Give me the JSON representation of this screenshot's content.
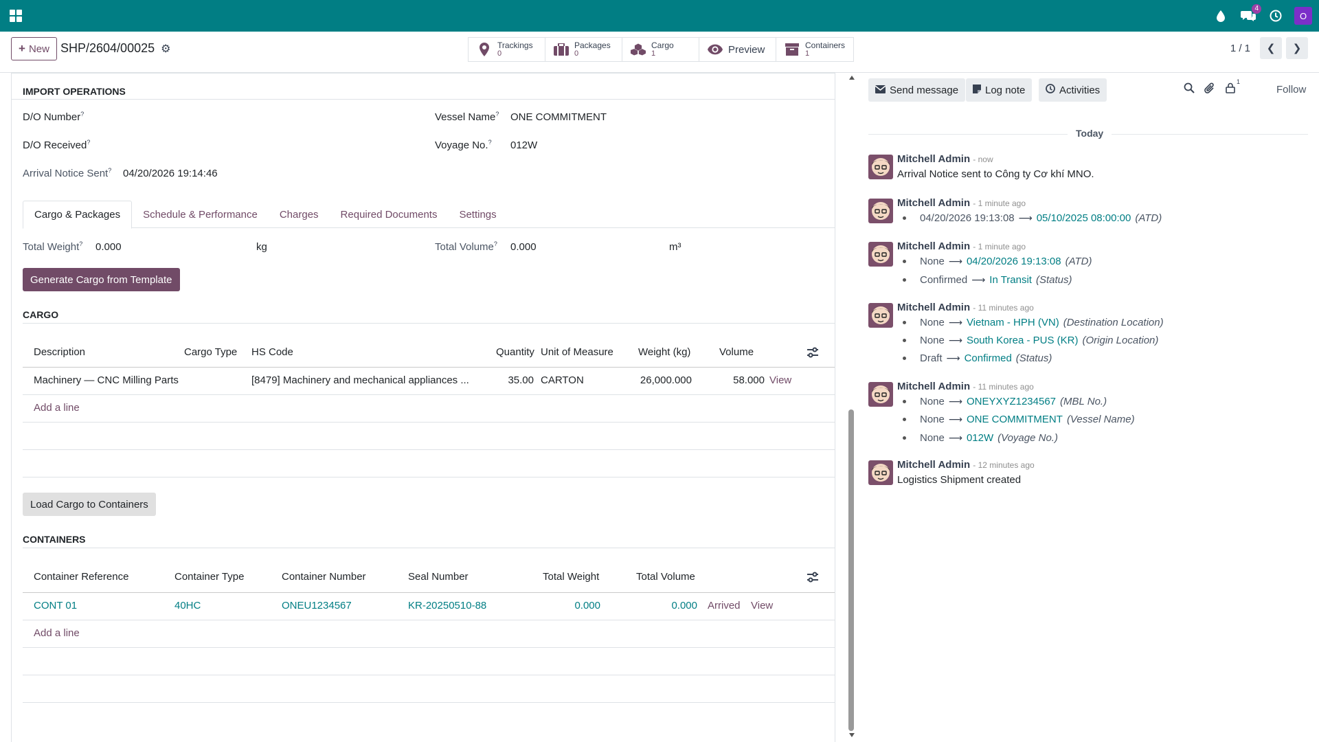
{
  "navbar": {
    "notif_count": "4",
    "avatar_letter": "O"
  },
  "control": {
    "new_label": "New",
    "record_name": "SHP/2604/00025",
    "smart_buttons": [
      {
        "label": "Trackings",
        "value": "0"
      },
      {
        "label": "Packages",
        "value": "0"
      },
      {
        "label": "Cargo",
        "value": "1"
      },
      {
        "label": "Preview",
        "value": ""
      },
      {
        "label": "Containers",
        "value": "1"
      }
    ],
    "pager": "1 / 1"
  },
  "form": {
    "import_ops_title": "IMPORT OPERATIONS",
    "do_number_label": "D/O Number",
    "do_received_label": "D/O Received",
    "arrival_notice_label": "Arrival Notice Sent",
    "arrival_notice_value": "04/20/2026 19:14:46",
    "vessel_name_label": "Vessel Name",
    "vessel_name_value": "ONE COMMITMENT",
    "voyage_label": "Voyage No.",
    "voyage_value": "012W",
    "help_mark": "?",
    "tabs": [
      {
        "label": "Cargo & Packages"
      },
      {
        "label": "Schedule & Performance"
      },
      {
        "label": "Charges"
      },
      {
        "label": "Required Documents"
      },
      {
        "label": "Settings"
      }
    ],
    "total_weight_label": "Total Weight",
    "total_weight_value": "0.000",
    "total_weight_unit": "kg",
    "total_volume_label": "Total Volume",
    "total_volume_value": "0.000",
    "total_volume_unit": "m³",
    "generate_btn": "Generate Cargo from Template",
    "cargo_title": "CARGO",
    "cargo_headers": [
      "Description",
      "Cargo Type",
      "HS Code",
      "Quantity",
      "Unit of Measure",
      "Weight (kg)",
      "Volume"
    ],
    "cargo_row": {
      "description": "Machinery — CNC Milling Parts",
      "cargo_type": "",
      "hs_code": "[8479] Machinery and mechanical appliances ...",
      "quantity": "35.00",
      "uom": "CARTON",
      "weight": "26,000.000",
      "volume": "58.000",
      "view": "View"
    },
    "add_line": "Add a line",
    "load_btn": "Load Cargo to Containers",
    "containers_title": "CONTAINERS",
    "container_headers": [
      "Container Reference",
      "Container Type",
      "Container Number",
      "Seal Number",
      "Total Weight",
      "Total Volume"
    ],
    "container_row": {
      "reference": "CONT 01",
      "type": "40HC",
      "number": "ONEU1234567",
      "seal": "KR-20250510-88",
      "weight": "0.000",
      "volume": "0.000",
      "status": "Arrived",
      "view": "View"
    }
  },
  "chatter": {
    "send_message": "Send message",
    "log_note": "Log note",
    "activities": "Activities",
    "followers_count": "1",
    "follow": "Follow",
    "today": "Today",
    "messages": [
      {
        "author": "Mitchell Admin",
        "time": "- now",
        "body": "Arrival Notice sent to Công ty Cơ khí MNO."
      },
      {
        "author": "Mitchell Admin",
        "time": "- 1 minute ago",
        "tracking": [
          {
            "old": "04/20/2026 19:13:08",
            "new": "05/10/2025 08:00:00",
            "field": "(ATD)"
          }
        ]
      },
      {
        "author": "Mitchell Admin",
        "time": "- 1 minute ago",
        "tracking": [
          {
            "old": "None",
            "new": "04/20/2026 19:13:08",
            "field": "(ATD)"
          },
          {
            "old": "Confirmed",
            "new": "In Transit",
            "field": "(Status)"
          }
        ]
      },
      {
        "author": "Mitchell Admin",
        "time": "- 11 minutes ago",
        "tracking": [
          {
            "old": "None",
            "new": "Vietnam - HPH (VN)",
            "field": "(Destination Location)"
          },
          {
            "old": "None",
            "new": "South Korea - PUS (KR)",
            "field": "(Origin Location)"
          },
          {
            "old": "Draft",
            "new": "Confirmed",
            "field": "(Status)"
          }
        ]
      },
      {
        "author": "Mitchell Admin",
        "time": "- 11 minutes ago",
        "tracking": [
          {
            "old": "None",
            "new": "ONEYXYZ1234567",
            "field": "(MBL No.)"
          },
          {
            "old": "None",
            "new": "ONE COMMITMENT",
            "field": "(Vessel Name)"
          },
          {
            "old": "None",
            "new": "012W",
            "field": "(Voyage No.)"
          }
        ]
      },
      {
        "author": "Mitchell Admin",
        "time": "- 12 minutes ago",
        "body": "Logistics Shipment created"
      }
    ]
  }
}
